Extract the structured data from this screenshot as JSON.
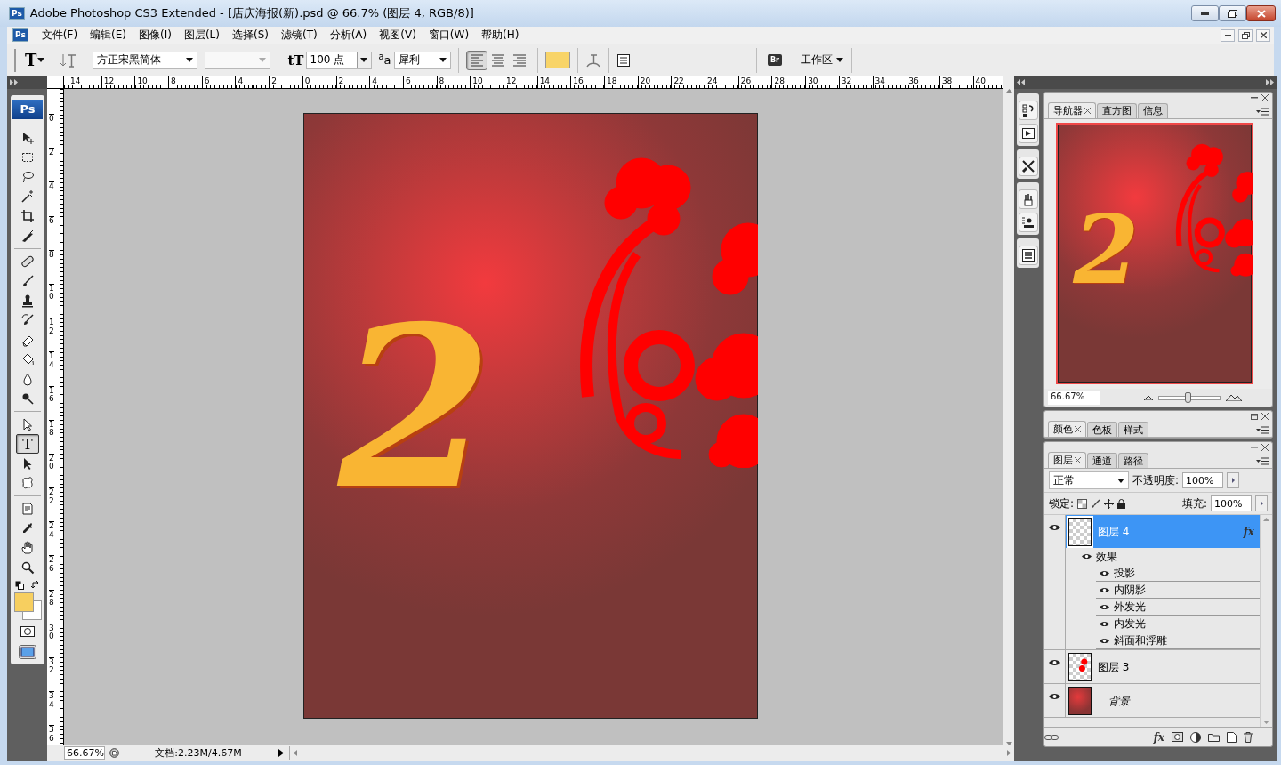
{
  "window": {
    "app_icon": "Ps",
    "title": "Adobe Photoshop CS3 Extended - [店庆海报(新).psd @ 66.7% (图层 4, RGB/8)]"
  },
  "menu": {
    "doc_icon": "Ps",
    "items": [
      "文件(F)",
      "编辑(E)",
      "图像(I)",
      "图层(L)",
      "选择(S)",
      "滤镜(T)",
      "分析(A)",
      "视图(V)",
      "窗口(W)",
      "帮助(H)"
    ]
  },
  "options_bar": {
    "tool_glyph": "T",
    "font_family": "方正宋黑简体",
    "font_style": "-",
    "size_glyph": "tT",
    "font_size": "100 点",
    "antialias_glyph": "$^{a}$a",
    "antialias": "犀利",
    "alignments": [
      {
        "selected": true
      },
      {
        "selected": false
      },
      {
        "selected": false
      }
    ],
    "bridge_glyph": "Br",
    "workspace": "工作区"
  },
  "toolbox": {
    "logo": "Ps",
    "tools": [
      {
        "selected": false
      },
      {
        "selected": false
      },
      {
        "selected": false
      },
      {
        "selected": false
      },
      {
        "selected": false
      },
      {
        "selected": false
      },
      {
        "selected": false
      },
      {
        "selected": false
      },
      {
        "selected": false
      },
      {
        "selected": false
      },
      {
        "selected": false
      },
      {
        "selected": false
      },
      {
        "selected": false
      },
      {
        "selected": false
      },
      {
        "selected": false
      },
      {
        "selected": true,
        "glyph": "T"
      },
      {
        "selected": false
      },
      {
        "selected": false
      },
      {
        "selected": false
      },
      {
        "selected": false
      },
      {
        "selected": false
      },
      {
        "selected": false
      }
    ]
  },
  "rulers": {
    "horizontal": [
      "14",
      "12",
      "10",
      "8",
      "6",
      "4",
      "2",
      "0",
      "2",
      "4",
      "6",
      "8",
      "10",
      "12",
      "14",
      "16",
      "18",
      "20",
      "22",
      "24",
      "26",
      "28",
      "30",
      "32",
      "34",
      "36",
      "38",
      "40"
    ],
    "vertical": [
      "0",
      "2",
      "4",
      "6",
      "8",
      "10",
      "12",
      "14",
      "16",
      "18",
      "20",
      "22",
      "24",
      "26",
      "28",
      "30",
      "32",
      "34",
      "36"
    ]
  },
  "document": {
    "text": "2"
  },
  "status_bar": {
    "zoom": "66.67%",
    "doc_info": "文档:2.23M/4.67M"
  },
  "navigator": {
    "tabs": [
      {
        "label": "导航器",
        "selected": true
      },
      {
        "label": "直方图",
        "selected": false
      },
      {
        "label": "信息",
        "selected": false
      }
    ],
    "preview_text": "2",
    "zoom": "66.67%",
    "level": 0.47
  },
  "color_panel": {
    "tabs": [
      {
        "label": "颜色",
        "selected": true
      },
      {
        "label": "色板",
        "selected": false
      },
      {
        "label": "样式",
        "selected": false
      }
    ]
  },
  "layers_panel": {
    "tabs": [
      {
        "label": "图层",
        "selected": true
      },
      {
        "label": "通道",
        "selected": false
      },
      {
        "label": "路径",
        "selected": false
      }
    ],
    "blend_mode": "正常",
    "opacity_label": "不透明度:",
    "opacity": "100%",
    "lock_label": "锁定:",
    "fill_label": "填充:",
    "fill": "100%",
    "layers": [
      {
        "kind": "text",
        "name": "图层 4",
        "selected": true,
        "visible": true,
        "fx": "fx",
        "effects_label": "效果",
        "effects": [
          {
            "name": "投影",
            "visible": true
          },
          {
            "name": "内阴影",
            "visible": true
          },
          {
            "name": "外发光",
            "visible": true
          },
          {
            "name": "内发光",
            "visible": true
          },
          {
            "name": "斜面和浮雕",
            "visible": true
          }
        ]
      },
      {
        "kind": "normal",
        "name": "图层 3",
        "selected": false,
        "visible": true
      },
      {
        "kind": "background",
        "name": "背景",
        "selected": false,
        "visible": true
      }
    ],
    "footer_fx": "fx"
  }
}
